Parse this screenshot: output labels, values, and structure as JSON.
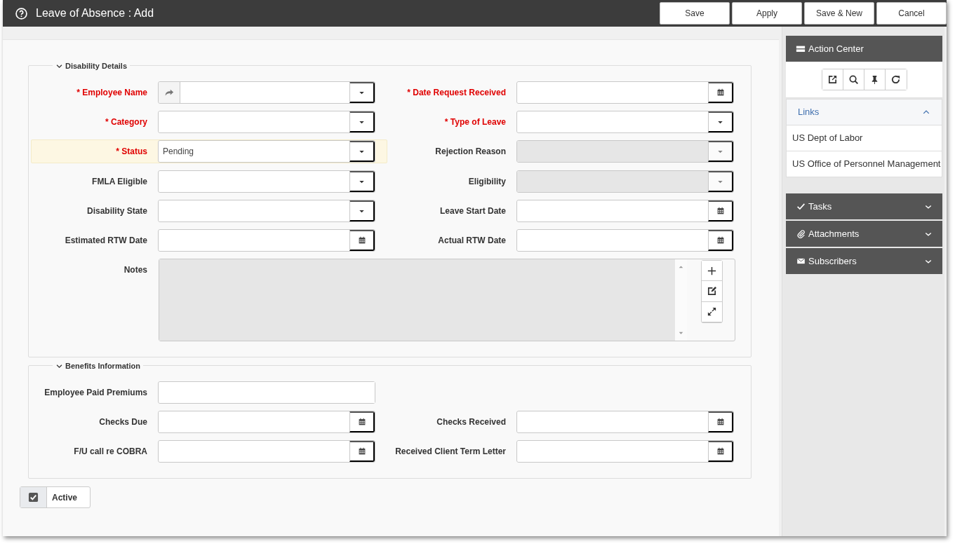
{
  "window": {
    "title": "Leave of Absence : Add"
  },
  "toolbar_buttons": [
    "Save",
    "Apply",
    "Save & New",
    "Cancel"
  ],
  "sections": [
    {
      "title": "Disability Details",
      "expanded": true,
      "rows": [
        [
          {
            "label": "* Employee Name",
            "kind": "lookup",
            "required": true
          },
          {
            "label": "* Date Request Received",
            "kind": "date",
            "required": true
          }
        ],
        [
          {
            "label": "* Category",
            "kind": "combo",
            "required": true
          },
          {
            "label": "* Type of Leave",
            "kind": "combo",
            "required": true
          }
        ],
        [
          {
            "label": "* Status",
            "kind": "combo",
            "required": true,
            "value": "Pending",
            "highlighted": true
          },
          {
            "label": "Rejection Reason",
            "kind": "combo",
            "disabled": true
          }
        ],
        [
          {
            "label": "FMLA Eligible",
            "kind": "combo"
          },
          {
            "label": "Eligibility",
            "kind": "combo",
            "disabled": true
          }
        ],
        [
          {
            "label": "Disability State",
            "kind": "combo"
          },
          {
            "label": "Leave Start Date",
            "kind": "date"
          }
        ],
        [
          {
            "label": "Estimated RTW Date",
            "kind": "date"
          },
          {
            "label": "Actual RTW Date",
            "kind": "date"
          }
        ],
        [
          {
            "label": "Notes",
            "kind": "notes",
            "disabled": true
          }
        ]
      ]
    },
    {
      "title": "Benefits Information",
      "expanded": true,
      "rows": [
        [
          {
            "label": "Employee Paid Premiums",
            "kind": "text"
          }
        ],
        [
          {
            "label": "Checks Due",
            "kind": "date"
          },
          {
            "label": "Checks Received",
            "kind": "date"
          }
        ],
        [
          {
            "label": "F/U call re COBRA",
            "kind": "date"
          },
          {
            "label": "Received Client Term Letter",
            "kind": "date"
          }
        ]
      ]
    }
  ],
  "active": {
    "label": "Active",
    "checked": true
  },
  "action_center": {
    "title": "Action Center",
    "panels": [
      {
        "title": "Links",
        "kind": "links",
        "expanded": true,
        "items": [
          "US Dept of Labor",
          "US Office of Personnel Management"
        ]
      },
      {
        "title": "Tasks",
        "kind": "tasks",
        "expanded": false
      },
      {
        "title": "Attachments",
        "kind": "attachments",
        "expanded": false
      },
      {
        "title": "Subscribers",
        "kind": "subscribers",
        "expanded": false
      }
    ]
  }
}
